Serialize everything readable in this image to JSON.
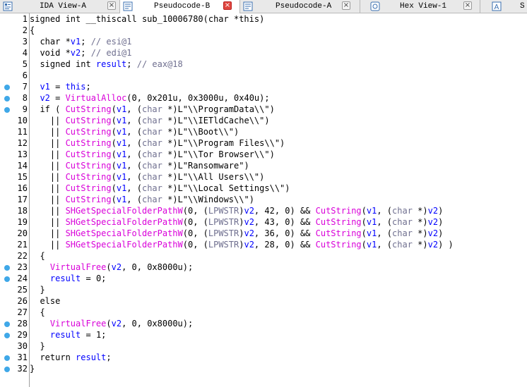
{
  "tabs": [
    {
      "label": "IDA View-A",
      "icon": "ida-view-icon",
      "active": false
    },
    {
      "label": "Pseudocode-B",
      "icon": "pseudocode-icon",
      "active": true
    },
    {
      "label": "Pseudocode-A",
      "icon": "pseudocode-icon",
      "active": false
    },
    {
      "label": "Hex View-1",
      "icon": "hex-view-icon",
      "active": false
    },
    {
      "label": "S",
      "icon": "structures-icon",
      "active": false
    }
  ],
  "colors": {
    "keyword": "#000000",
    "variable": "#0000ff",
    "function": "#d900d9",
    "comment": "#6f6f8f",
    "breakpoint_dot": "#3fa8e8"
  },
  "code": {
    "lines": [
      {
        "n": "1",
        "dot": false,
        "tokens": [
          [
            "p",
            "signed int __thiscall sub_10006780(char *this)"
          ]
        ]
      },
      {
        "n": "2",
        "dot": false,
        "tokens": [
          [
            "p",
            "{"
          ]
        ]
      },
      {
        "n": "3",
        "dot": false,
        "tokens": [
          [
            "p",
            "  char *"
          ],
          [
            "v",
            "v1"
          ],
          [
            "p",
            "; "
          ],
          [
            "c",
            "// esi@1"
          ]
        ]
      },
      {
        "n": "4",
        "dot": false,
        "tokens": [
          [
            "p",
            "  void *"
          ],
          [
            "v",
            "v2"
          ],
          [
            "p",
            "; "
          ],
          [
            "c",
            "// edi@1"
          ]
        ]
      },
      {
        "n": "5",
        "dot": false,
        "tokens": [
          [
            "p",
            "  signed int "
          ],
          [
            "v",
            "result"
          ],
          [
            "p",
            "; "
          ],
          [
            "c",
            "// eax@18"
          ]
        ]
      },
      {
        "n": "6",
        "dot": false,
        "tokens": [
          [
            "p",
            ""
          ]
        ]
      },
      {
        "n": "7",
        "dot": true,
        "tokens": [
          [
            "p",
            "  "
          ],
          [
            "v",
            "v1"
          ],
          [
            "p",
            " = "
          ],
          [
            "v",
            "this"
          ],
          [
            "p",
            ";"
          ]
        ]
      },
      {
        "n": "8",
        "dot": true,
        "tokens": [
          [
            "p",
            "  "
          ],
          [
            "v",
            "v2"
          ],
          [
            "p",
            " = "
          ],
          [
            "f",
            "VirtualAlloc"
          ],
          [
            "p",
            "(0, 0x201u, 0x3000u, 0x40u);"
          ]
        ]
      },
      {
        "n": "9",
        "dot": true,
        "tokens": [
          [
            "p",
            "  if ( "
          ],
          [
            "f",
            "CutString"
          ],
          [
            "p",
            "("
          ],
          [
            "v",
            "v1"
          ],
          [
            "p",
            ", ("
          ],
          [
            "c",
            "char"
          ],
          [
            "p",
            " *)L\"\\\\ProgramData\\\\\")"
          ]
        ]
      },
      {
        "n": "10",
        "dot": false,
        "tokens": [
          [
            "p",
            "    || "
          ],
          [
            "f",
            "CutString"
          ],
          [
            "p",
            "("
          ],
          [
            "v",
            "v1"
          ],
          [
            "p",
            ", ("
          ],
          [
            "c",
            "char"
          ],
          [
            "p",
            " *)L\"\\\\IETldCache\\\\\")"
          ]
        ]
      },
      {
        "n": "11",
        "dot": false,
        "tokens": [
          [
            "p",
            "    || "
          ],
          [
            "f",
            "CutString"
          ],
          [
            "p",
            "("
          ],
          [
            "v",
            "v1"
          ],
          [
            "p",
            ", ("
          ],
          [
            "c",
            "char"
          ],
          [
            "p",
            " *)L\"\\\\Boot\\\\\")"
          ]
        ]
      },
      {
        "n": "12",
        "dot": false,
        "tokens": [
          [
            "p",
            "    || "
          ],
          [
            "f",
            "CutString"
          ],
          [
            "p",
            "("
          ],
          [
            "v",
            "v1"
          ],
          [
            "p",
            ", ("
          ],
          [
            "c",
            "char"
          ],
          [
            "p",
            " *)L\"\\\\Program Files\\\\\")"
          ]
        ]
      },
      {
        "n": "13",
        "dot": false,
        "tokens": [
          [
            "p",
            "    || "
          ],
          [
            "f",
            "CutString"
          ],
          [
            "p",
            "("
          ],
          [
            "v",
            "v1"
          ],
          [
            "p",
            ", ("
          ],
          [
            "c",
            "char"
          ],
          [
            "p",
            " *)L\"\\\\Tor Browser\\\\\")"
          ]
        ]
      },
      {
        "n": "14",
        "dot": false,
        "tokens": [
          [
            "p",
            "    || "
          ],
          [
            "f",
            "CutString"
          ],
          [
            "p",
            "("
          ],
          [
            "v",
            "v1"
          ],
          [
            "p",
            ", ("
          ],
          [
            "c",
            "char"
          ],
          [
            "p",
            " *)L\"Ransomware\")"
          ]
        ]
      },
      {
        "n": "15",
        "dot": false,
        "tokens": [
          [
            "p",
            "    || "
          ],
          [
            "f",
            "CutString"
          ],
          [
            "p",
            "("
          ],
          [
            "v",
            "v1"
          ],
          [
            "p",
            ", ("
          ],
          [
            "c",
            "char"
          ],
          [
            "p",
            " *)L\"\\\\All Users\\\\\")"
          ]
        ]
      },
      {
        "n": "16",
        "dot": false,
        "tokens": [
          [
            "p",
            "    || "
          ],
          [
            "f",
            "CutString"
          ],
          [
            "p",
            "("
          ],
          [
            "v",
            "v1"
          ],
          [
            "p",
            ", ("
          ],
          [
            "c",
            "char"
          ],
          [
            "p",
            " *)L\"\\\\Local Settings\\\\\")"
          ]
        ]
      },
      {
        "n": "17",
        "dot": false,
        "tokens": [
          [
            "p",
            "    || "
          ],
          [
            "f",
            "CutString"
          ],
          [
            "p",
            "("
          ],
          [
            "v",
            "v1"
          ],
          [
            "p",
            ", ("
          ],
          [
            "c",
            "char"
          ],
          [
            "p",
            " *)L\"\\\\Windows\\\\\")"
          ]
        ]
      },
      {
        "n": "18",
        "dot": false,
        "tokens": [
          [
            "p",
            "    || "
          ],
          [
            "f",
            "SHGetSpecialFolderPathW"
          ],
          [
            "p",
            "(0, ("
          ],
          [
            "c",
            "LPWSTR"
          ],
          [
            "p",
            ")"
          ],
          [
            "v",
            "v2"
          ],
          [
            "p",
            ", 42, 0) && "
          ],
          [
            "f",
            "CutString"
          ],
          [
            "p",
            "("
          ],
          [
            "v",
            "v1"
          ],
          [
            "p",
            ", ("
          ],
          [
            "c",
            "char"
          ],
          [
            "p",
            " *)"
          ],
          [
            "v",
            "v2"
          ],
          [
            "p",
            ")"
          ]
        ]
      },
      {
        "n": "19",
        "dot": false,
        "tokens": [
          [
            "p",
            "    || "
          ],
          [
            "f",
            "SHGetSpecialFolderPathW"
          ],
          [
            "p",
            "(0, ("
          ],
          [
            "c",
            "LPWSTR"
          ],
          [
            "p",
            ")"
          ],
          [
            "v",
            "v2"
          ],
          [
            "p",
            ", 43, 0) && "
          ],
          [
            "f",
            "CutString"
          ],
          [
            "p",
            "("
          ],
          [
            "v",
            "v1"
          ],
          [
            "p",
            ", ("
          ],
          [
            "c",
            "char"
          ],
          [
            "p",
            " *)"
          ],
          [
            "v",
            "v2"
          ],
          [
            "p",
            ")"
          ]
        ]
      },
      {
        "n": "20",
        "dot": false,
        "tokens": [
          [
            "p",
            "    || "
          ],
          [
            "f",
            "SHGetSpecialFolderPathW"
          ],
          [
            "p",
            "(0, ("
          ],
          [
            "c",
            "LPWSTR"
          ],
          [
            "p",
            ")"
          ],
          [
            "v",
            "v2"
          ],
          [
            "p",
            ", 36, 0) && "
          ],
          [
            "f",
            "CutString"
          ],
          [
            "p",
            "("
          ],
          [
            "v",
            "v1"
          ],
          [
            "p",
            ", ("
          ],
          [
            "c",
            "char"
          ],
          [
            "p",
            " *)"
          ],
          [
            "v",
            "v2"
          ],
          [
            "p",
            ")"
          ]
        ]
      },
      {
        "n": "21",
        "dot": false,
        "tokens": [
          [
            "p",
            "    || "
          ],
          [
            "f",
            "SHGetSpecialFolderPathW"
          ],
          [
            "p",
            "(0, ("
          ],
          [
            "c",
            "LPWSTR"
          ],
          [
            "p",
            ")"
          ],
          [
            "v",
            "v2"
          ],
          [
            "p",
            ", 28, 0) && "
          ],
          [
            "f",
            "CutString"
          ],
          [
            "p",
            "("
          ],
          [
            "v",
            "v1"
          ],
          [
            "p",
            ", ("
          ],
          [
            "c",
            "char"
          ],
          [
            "p",
            " *)"
          ],
          [
            "v",
            "v2"
          ],
          [
            "p",
            ") )"
          ]
        ]
      },
      {
        "n": "22",
        "dot": false,
        "tokens": [
          [
            "p",
            "  {"
          ]
        ]
      },
      {
        "n": "23",
        "dot": true,
        "tokens": [
          [
            "p",
            "    "
          ],
          [
            "f",
            "VirtualFree"
          ],
          [
            "p",
            "("
          ],
          [
            "v",
            "v2"
          ],
          [
            "p",
            ", 0, 0x8000u);"
          ]
        ]
      },
      {
        "n": "24",
        "dot": true,
        "tokens": [
          [
            "p",
            "    "
          ],
          [
            "v",
            "result"
          ],
          [
            "p",
            " = 0;"
          ]
        ]
      },
      {
        "n": "25",
        "dot": false,
        "tokens": [
          [
            "p",
            "  }"
          ]
        ]
      },
      {
        "n": "26",
        "dot": false,
        "tokens": [
          [
            "p",
            "  else"
          ]
        ]
      },
      {
        "n": "27",
        "dot": false,
        "tokens": [
          [
            "p",
            "  {"
          ]
        ]
      },
      {
        "n": "28",
        "dot": true,
        "tokens": [
          [
            "p",
            "    "
          ],
          [
            "f",
            "VirtualFree"
          ],
          [
            "p",
            "("
          ],
          [
            "v",
            "v2"
          ],
          [
            "p",
            ", 0, 0x8000u);"
          ]
        ]
      },
      {
        "n": "29",
        "dot": true,
        "tokens": [
          [
            "p",
            "    "
          ],
          [
            "v",
            "result"
          ],
          [
            "p",
            " = 1;"
          ]
        ]
      },
      {
        "n": "30",
        "dot": false,
        "tokens": [
          [
            "p",
            "  }"
          ]
        ]
      },
      {
        "n": "31",
        "dot": true,
        "tokens": [
          [
            "p",
            "  return "
          ],
          [
            "v",
            "result"
          ],
          [
            "p",
            ";"
          ]
        ]
      },
      {
        "n": "32",
        "dot": true,
        "tokens": [
          [
            "p",
            "}"
          ]
        ]
      }
    ]
  }
}
